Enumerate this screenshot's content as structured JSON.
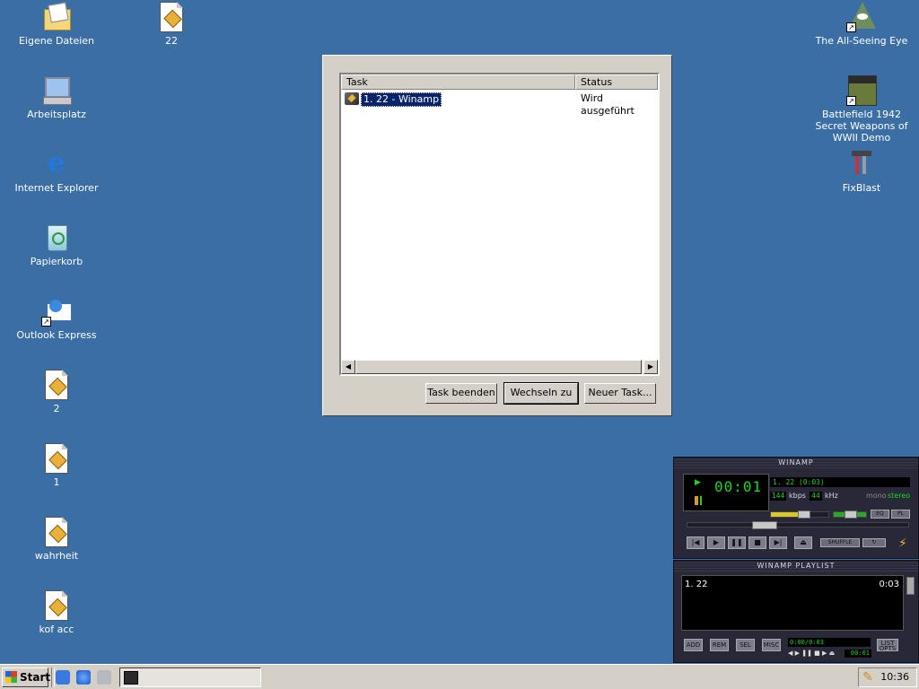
{
  "desktop": {
    "icons_left": [
      {
        "label": "Eigene Dateien",
        "icon": "my-documents-icon"
      },
      {
        "label": "Arbeitsplatz",
        "icon": "my-computer-icon"
      },
      {
        "label": "Internet Explorer",
        "icon": "internet-explorer-icon"
      },
      {
        "label": "Papierkorb",
        "icon": "recycle-bin-icon"
      },
      {
        "label": "Outlook Express",
        "icon": "outlook-express-icon"
      },
      {
        "label": "2",
        "icon": "winamp-file-icon"
      },
      {
        "label": "1",
        "icon": "winamp-file-icon"
      },
      {
        "label": "wahrheit",
        "icon": "winamp-file-icon"
      },
      {
        "label": "kof acc",
        "icon": "winamp-file-icon"
      }
    ],
    "icon_22": {
      "label": "22",
      "icon": "winamp-file-icon"
    },
    "icons_right": [
      {
        "label": "The All-Seeing Eye",
        "icon": "all-seeing-eye-icon"
      },
      {
        "label": "Battlefield 1942 Secret Weapons of WWII Demo",
        "icon": "battlefield-icon"
      },
      {
        "label": "FixBlast",
        "icon": "fixblast-icon"
      }
    ]
  },
  "task_manager": {
    "columns": [
      "Task",
      "Status"
    ],
    "tasks": [
      {
        "name": "1. 22 - Winamp",
        "status": "Wird ausgeführt"
      }
    ],
    "buttons": {
      "end_task": "Task beenden",
      "switch_to": "Wechseln zu",
      "new_task": "Neuer Task..."
    }
  },
  "winamp": {
    "title": "WINAMP",
    "time": "00:01",
    "song": "1. 22 (0:03)",
    "kbps": "144",
    "kbps_label": "kbps",
    "khz": "44",
    "khz_label": "kHz",
    "mono_label": "mono",
    "stereo_label": "stereo",
    "eq_label": "EQ",
    "pl_label": "PL",
    "shuffle_label": "SHUFFLE",
    "controls": [
      "|◀",
      "▶",
      "❚❚",
      "■",
      "▶|",
      "⏏"
    ]
  },
  "playlist": {
    "title": "WINAMP PLAYLIST",
    "items": [
      {
        "name": "1. 22",
        "duration": "0:03"
      }
    ],
    "info": "0:00/0:03",
    "elapsed": "00:01",
    "buttons": [
      "ADD",
      "REM",
      "SEL",
      "MISC"
    ],
    "list_opts": "LIST OPTS"
  },
  "taskbar": {
    "start_label": "Start",
    "clock": "10:36"
  }
}
